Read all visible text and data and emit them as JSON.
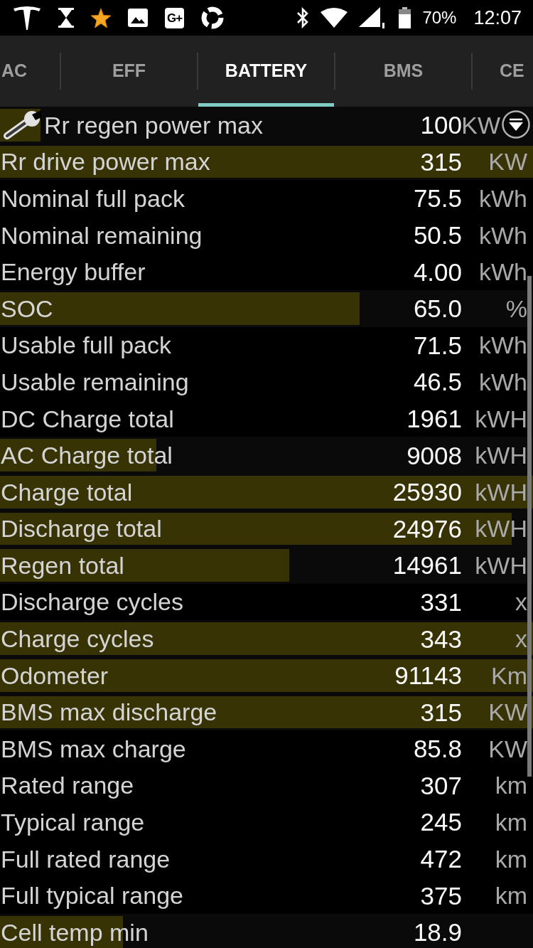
{
  "status_bar": {
    "notification_text": "G+",
    "battery": "70%",
    "time": "12:07"
  },
  "tabs": [
    {
      "label": "AC",
      "selected": false
    },
    {
      "label": "EFF",
      "selected": false
    },
    {
      "label": "BATTERY",
      "selected": true
    },
    {
      "label": "BMS",
      "selected": false
    },
    {
      "label": "CE",
      "selected": false
    }
  ],
  "rows": [
    {
      "label": "Rr regen power max",
      "value": "100",
      "unit": "KW",
      "level": 0.076
    },
    {
      "label": "Rr drive power max",
      "value": "315",
      "unit": "KW",
      "level": 1
    },
    {
      "label": "Nominal full pack",
      "value": "75.5",
      "unit": "kWh"
    },
    {
      "label": "Nominal remaining",
      "value": "50.5",
      "unit": "kWh"
    },
    {
      "label": "Energy buffer",
      "value": "4.00",
      "unit": "kWh"
    },
    {
      "label": "SOC",
      "value": "65.0",
      "unit": "%",
      "level": 0.675
    },
    {
      "label": "Usable full pack",
      "value": "71.5",
      "unit": "kWh"
    },
    {
      "label": "Usable remaining",
      "value": "46.5",
      "unit": "kWh"
    },
    {
      "label": "DC Charge total",
      "value": "1961",
      "unit": "kWH"
    },
    {
      "label": "AC Charge total",
      "value": "9008",
      "unit": "kWH",
      "level": 0.293
    },
    {
      "label": "Charge total",
      "value": "25930",
      "unit": "kWH",
      "level": 1
    },
    {
      "label": "Discharge total",
      "value": "24976",
      "unit": "kWH",
      "level": 0.96
    },
    {
      "label": "Regen total",
      "value": "14961",
      "unit": "kWH",
      "level": 0.543
    },
    {
      "label": "Discharge cycles",
      "value": "331",
      "unit": "x"
    },
    {
      "label": "Charge cycles",
      "value": "343",
      "unit": "x",
      "level": 1
    },
    {
      "label": "Odometer",
      "value": "91143",
      "unit": "Km",
      "level": 1
    },
    {
      "label": "BMS max discharge",
      "value": "315",
      "unit": "KW",
      "level": 1
    },
    {
      "label": "BMS max charge",
      "value": "85.8",
      "unit": "KW"
    },
    {
      "label": "Rated range",
      "value": "307",
      "unit": "km"
    },
    {
      "label": "Typical range",
      "value": "245",
      "unit": "km"
    },
    {
      "label": "Full rated range",
      "value": "472",
      "unit": "km"
    },
    {
      "label": "Full typical range",
      "value": "375",
      "unit": "km"
    },
    {
      "label": "Cell temp min",
      "value": "18.9",
      "level": 0.23
    }
  ]
}
